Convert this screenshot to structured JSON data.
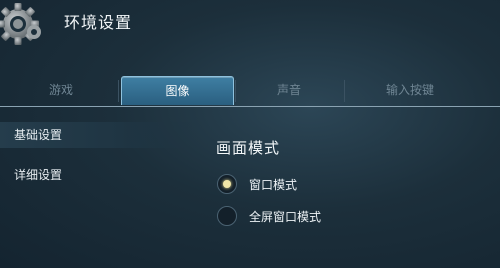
{
  "header": {
    "title": "环境设置",
    "icon": "gear-icon"
  },
  "tabs": [
    {
      "label": "游戏",
      "active": false
    },
    {
      "label": "图像",
      "active": true
    },
    {
      "label": "声音",
      "active": false
    },
    {
      "label": "输入按键",
      "active": false
    }
  ],
  "sidebar": {
    "items": [
      {
        "label": "基础设置",
        "selected": true
      },
      {
        "label": "详细设置",
        "selected": false
      }
    ]
  },
  "main": {
    "section_title": "画面模式",
    "options": [
      {
        "label": "窗口模式",
        "selected": true
      },
      {
        "label": "全屏窗口模式",
        "selected": false
      }
    ]
  },
  "colors": {
    "accent": "#3f7fa3",
    "radio_dot": "#f0e6a8",
    "background": "#1c2f3b"
  }
}
